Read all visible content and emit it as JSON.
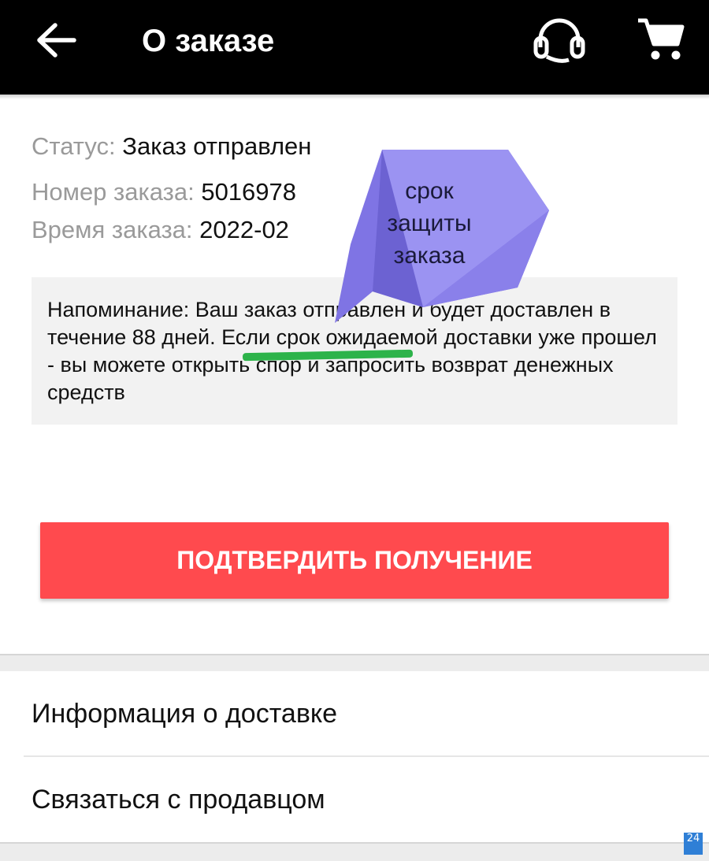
{
  "header": {
    "title": "О заказе",
    "back_icon": "arrow-left-icon",
    "support_icon": "headset-icon",
    "cart_icon": "cart-icon"
  },
  "order": {
    "status_label": "Статус:",
    "status_value": "Заказ отправлен",
    "number_label": "Номер заказа:",
    "number_value": "5016978",
    "time_label": "Время заказа:",
    "time_value": "2022-02"
  },
  "notice": {
    "text": "Напоминание: Ваш заказ отправлен и будет доставлен в течение 88 дней. Если срок ожидаемой доставки уже прошел - вы можете открыть спор и запросить возврат денежных средств"
  },
  "annotation": {
    "line1": "срок",
    "line2": "защиты",
    "line3": "заказа",
    "bubble_color": "#8f86ee",
    "underline_color": "#2db34a"
  },
  "confirm_button": {
    "label": "ПОДТВЕРДИТЬ ПОЛУЧЕНИЕ",
    "color": "#ff4a4e"
  },
  "menu": {
    "items": [
      {
        "label": "Информация о доставке"
      },
      {
        "label": "Связаться с продавцом"
      }
    ]
  },
  "watermark": {
    "text": "24"
  }
}
